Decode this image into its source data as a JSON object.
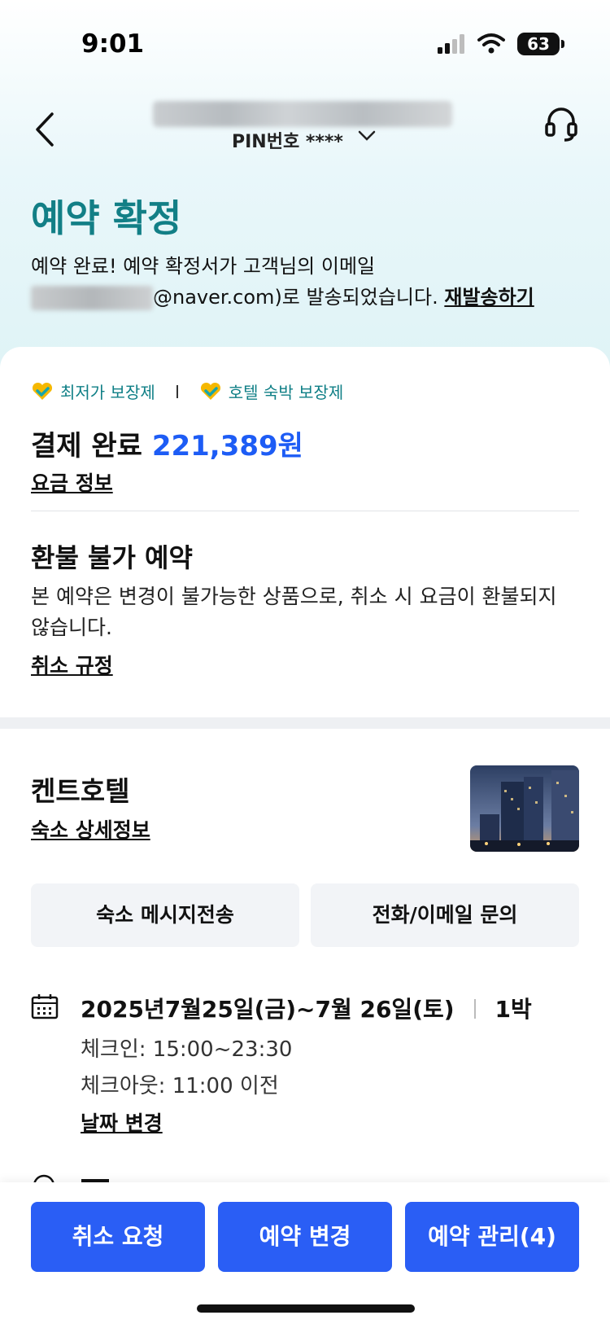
{
  "status_bar": {
    "time": "9:01",
    "battery": "63"
  },
  "nav": {
    "pin_label": "PIN번호 ****"
  },
  "header": {
    "title": "예약 확정",
    "intro_line1": "예약 완료! 예약 확정서가 고객님의 이메일",
    "email_suffix": "@naver.com)로 발송되었습니다.",
    "resend_label": "재발송하기"
  },
  "guarantees": [
    "최저가 보장제",
    "호텔 숙박 보장제"
  ],
  "payment": {
    "status": "결제 완료",
    "amount": "221,389원",
    "fare_link": "요금 정보"
  },
  "refund": {
    "title": "환불 불가 예약",
    "description": "본 예약은 변경이 불가능한 상품으로, 취소 시 요금이 환불되지 않습니다.",
    "policy_link": "취소 규정"
  },
  "hotel": {
    "name": "켄트호텔",
    "detail_link": "숙소 상세정보",
    "message_button": "숙소 메시지전송",
    "contact_button": "전화/이메일 문의"
  },
  "stay": {
    "dates": "2025년7월25일(금)~7월 26일(토)",
    "nights": "1박",
    "checkin": "체크인: 15:00~23:30",
    "checkout": "체크아웃: 11:00 이전",
    "change_link": "날짜 변경"
  },
  "bottom_actions": {
    "cancel": "취소 요청",
    "change": "예약 변경",
    "manage": "예약 관리(4)"
  },
  "colors": {
    "accent_teal": "#127f86",
    "primary_blue": "#2a5ef5",
    "amount_blue": "#1d5cf5"
  }
}
